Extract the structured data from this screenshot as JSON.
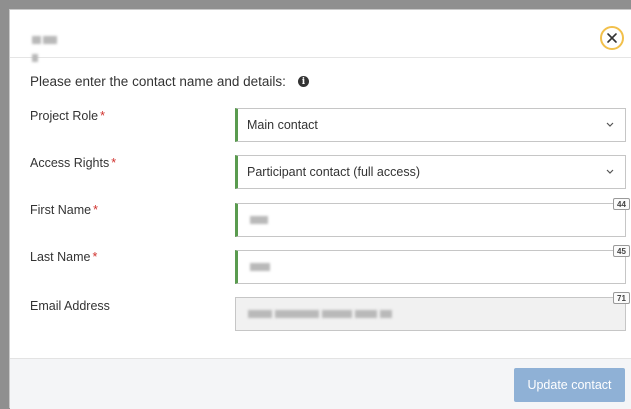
{
  "dialog": {
    "close_symbol": "×",
    "intro_text": "Please enter the contact name and details:",
    "info_icon_glyph": "i"
  },
  "form": {
    "project_role": {
      "label": "Project Role",
      "required_mark": "*",
      "value": "Main contact"
    },
    "access_rights": {
      "label": "Access Rights",
      "required_mark": "*",
      "value": "Participant contact (full access)"
    },
    "first_name": {
      "label": "First Name",
      "required_mark": "*",
      "remaining_chars": "44"
    },
    "last_name": {
      "label": "Last Name",
      "required_mark": "*",
      "remaining_chars": "45"
    },
    "email": {
      "label": "Email Address",
      "remaining_chars": "71"
    }
  },
  "footer": {
    "update_label": "Update contact"
  },
  "colors": {
    "valid_border": "#5a9b4f",
    "required": "#d0312d",
    "close_ring": "#f2c04b",
    "primary_disabled": "#8fb1d6"
  },
  "icons": {
    "close": "close-icon",
    "info": "info-icon",
    "dropdown": "chevron-down-icon"
  }
}
